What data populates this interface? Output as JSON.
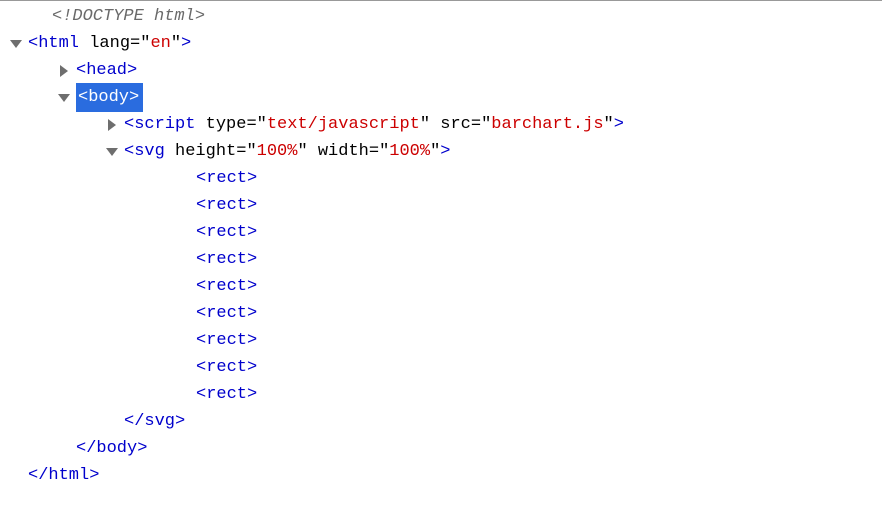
{
  "doctype": {
    "open": "<!DOCTYPE ",
    "name": "html",
    "close": ">"
  },
  "html": {
    "open_bracket": "<",
    "name": "html",
    "attr_lang_name": " lang",
    "eq": "=",
    "q": "\"",
    "attr_lang_val": "en",
    "close_bracket": ">",
    "close_open": "</",
    "close_name": "html",
    "close_close": ">"
  },
  "head": {
    "open": "<",
    "name": "head",
    "close": ">"
  },
  "body": {
    "open": "<",
    "name": "body",
    "close": ">",
    "close_open": "</",
    "close_name": "body",
    "close_close": ">"
  },
  "script_tag": {
    "open": "<",
    "name": "script",
    "attr_type_name": " type",
    "attr_type_val": "text/javascript",
    "attr_src_name": " src",
    "attr_src_val": "barchart.js",
    "close": ">"
  },
  "svg": {
    "open": "<",
    "name": "svg",
    "attr_h_name": " height",
    "attr_h_val": "100%",
    "attr_w_name": " width",
    "attr_w_val": "100%",
    "close": ">",
    "close_open": "</",
    "close_name": "svg",
    "close_close": ">"
  },
  "rect": {
    "open": "<",
    "name": "rect",
    "close": ">"
  },
  "rects_count": 9,
  "eq": "=",
  "q": "\""
}
